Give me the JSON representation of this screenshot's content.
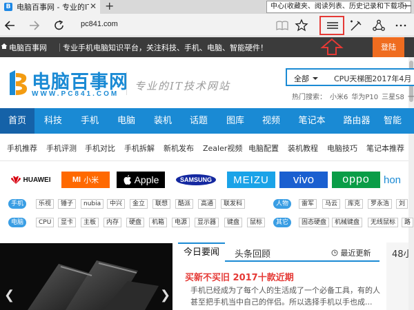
{
  "browser": {
    "tab_title": "电脑百事网 - 专业的IT技",
    "tab_favicon_letter": "B",
    "new_tab_symbol": "+",
    "close_symbol": "✕",
    "tooltip": "中心(收藏夹、阅读列表、历史记录和下载项)",
    "window_minimize": "—",
    "url": "pc841.com",
    "icons": [
      "back-icon",
      "forward-icon",
      "refresh-icon",
      "reading-view-icon",
      "favorite-star-icon",
      "hub-icon",
      "web-note-icon",
      "share-icon",
      "more-icon"
    ]
  },
  "topbar": {
    "site_name": "电脑百事网",
    "slogan": "专业手机电脑知识平台，关注科技、手机、电脑、智能硬件！",
    "login": "登陆"
  },
  "header": {
    "logo_cn": "电脑百事网",
    "logo_en": "WWW.PC841.COM",
    "logo_slogan": "专业的IT技术网站",
    "search_category": "全部",
    "search_placeholder": "CPU天梯图2017年4月",
    "hot_search_label": "热门搜索：",
    "hot_search_terms": [
      "小米6",
      "华为P10",
      "三星S8",
      "一加3T"
    ]
  },
  "mainnav": [
    "首页",
    "科技",
    "手机",
    "电脑",
    "装机",
    "话题",
    "图库",
    "视频",
    "笔记本",
    "路由器",
    "智能"
  ],
  "subnav": [
    "手机推荐",
    "手机评测",
    "手机对比",
    "手机拆解",
    "新机发布",
    "Zealer视频",
    "电脑配置",
    "装机教程",
    "电脑技巧",
    "笔记本推荐"
  ],
  "brands": {
    "huawei": "HUAWEI",
    "mi": "小米",
    "mi_logo": "MI",
    "apple": "Apple",
    "samsung": "SAMSUNG",
    "meizu": "MEIZU",
    "vivo": "vivo",
    "oppo": "oppo",
    "honor": "hon"
  },
  "tags": {
    "row1_badge": "手机",
    "row1": [
      "乐视",
      "锤子",
      "nubia",
      "中兴",
      "金立",
      "联想",
      "酷派",
      "高通",
      "联发科"
    ],
    "row1_right_badge": "人物",
    "row1_right": [
      "雷军",
      "马云",
      "库克",
      "罗永浩",
      "刘"
    ],
    "row2_badge": "电脑",
    "row2": [
      "CPU",
      "显卡",
      "主板",
      "内存",
      "硬盘",
      "机箱",
      "电源",
      "显示器",
      "键盘",
      "鼠标"
    ],
    "row2_right_badge": "其它",
    "row2_right": [
      "固态硬盘",
      "机械键盘",
      "无线鼠标",
      "路"
    ]
  },
  "news": {
    "tab_active": "今日要闻",
    "tab_other": "头条回顾",
    "more": "最近更新",
    "headline": "买新不买旧 2017十款近期",
    "summary": "手机已经成为了每个人的生活成了一个必备工具，有的人甚至把手机当中自己的伴侣。所以选择手机以手也成...",
    "side_title": "48小"
  },
  "colors": {
    "brand_blue": "#1a8ad4",
    "nav_active": "#1562a8",
    "login_orange": "#ef6c1f",
    "headline_red": "#e53935"
  }
}
